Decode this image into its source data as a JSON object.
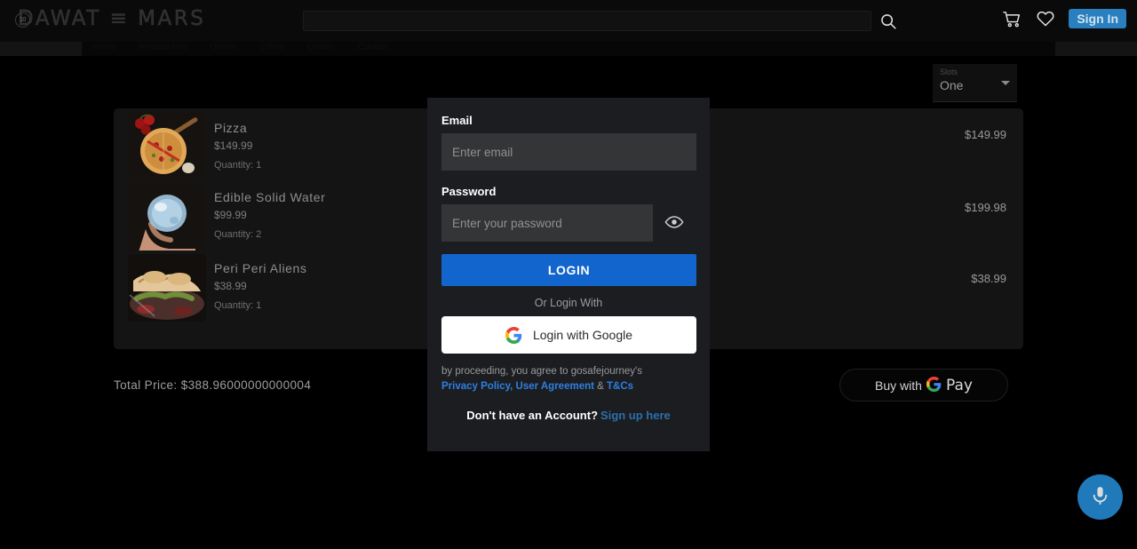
{
  "header": {
    "logo_badge": "10",
    "logo_text": "DAWAT ≡ MARS",
    "search_placeholder": "",
    "search_value": "",
    "search_icon": "search-icon",
    "cart_icon": "shopping-cart-icon",
    "wishlist_icon": "heart-icon",
    "signin_label": "Sign In"
  },
  "subnav": {
    "items": [
      "Home",
      "Restaurants",
      "Dishes",
      "Offers",
      "Orders",
      "Contact"
    ]
  },
  "slots": {
    "label": "Slots",
    "value": "One",
    "caret_icon": "chevron-down-icon"
  },
  "cart": {
    "items": [
      {
        "name": "Pizza",
        "price": "$149.99",
        "quantity": "Quantity: 1",
        "line_total": "$149.99",
        "image": "pizza-thumbnail"
      },
      {
        "name": "Edible Solid Water",
        "price": "$99.99",
        "quantity": "Quantity: 2",
        "line_total": "$199.98",
        "image": "edible-water-thumbnail"
      },
      {
        "name": "Peri Peri Aliens",
        "price": "$38.99",
        "quantity": "Quantity: 1",
        "line_total": "$38.99",
        "image": "peri-peri-thumbnail"
      }
    ],
    "total_price": "Total Price: $388.96000000000004",
    "gpay_label": "Buy with",
    "gpay_word": "Pay",
    "gpay_icon": "google-g-icon"
  },
  "login_modal": {
    "email_label": "Email",
    "email_placeholder": "Enter email",
    "email_value": "",
    "password_label": "Password",
    "password_placeholder": "Enter your password",
    "password_value": "",
    "eye_icon": "eye-icon",
    "login_label": "LOGIN",
    "or_text": "Or Login With",
    "google_label": "Login with Google",
    "google_icon": "google-g-icon",
    "terms_prefix": "by proceeding, you agree to gosafejourney's",
    "terms_privacy": "Privacy Policy, User Agreement",
    "terms_amp": "&",
    "terms_tcs": "T&Cs",
    "signup_prompt": "Don't have an Account?",
    "signup_link": "Sign up here"
  },
  "mic_fab": {
    "icon": "microphone-icon"
  },
  "colors": {
    "accent_blue": "#1265cd",
    "signin_blue": "#2a7fbf",
    "link_blue": "#2f7fe0",
    "mic_blue": "#2079b8",
    "modal_bg": "#1b1d21",
    "page_bg": "#000000"
  }
}
